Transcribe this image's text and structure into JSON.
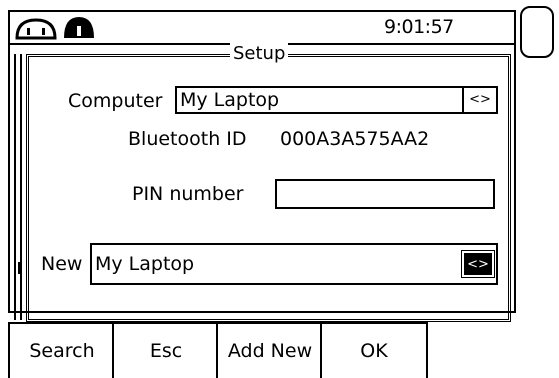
{
  "status": {
    "time": "9:01:57"
  },
  "icons": {
    "plug": "mains-plug-icon",
    "lock": "lock-icon"
  },
  "panel": {
    "title": "Setup"
  },
  "form": {
    "computer_label": "Computer",
    "computer_value": "My Laptop",
    "computer_selector": "<>",
    "bt_label": "Bluetooth ID",
    "bt_value": "000A3A575AA2",
    "pin_label": "PIN number",
    "pin_value": "",
    "new_label": "New",
    "new_value": "My Laptop",
    "new_selector": "<>"
  },
  "softkeys": [
    {
      "label": "Search"
    },
    {
      "label": "Esc"
    },
    {
      "label": "Add New"
    },
    {
      "label": "OK"
    }
  ]
}
